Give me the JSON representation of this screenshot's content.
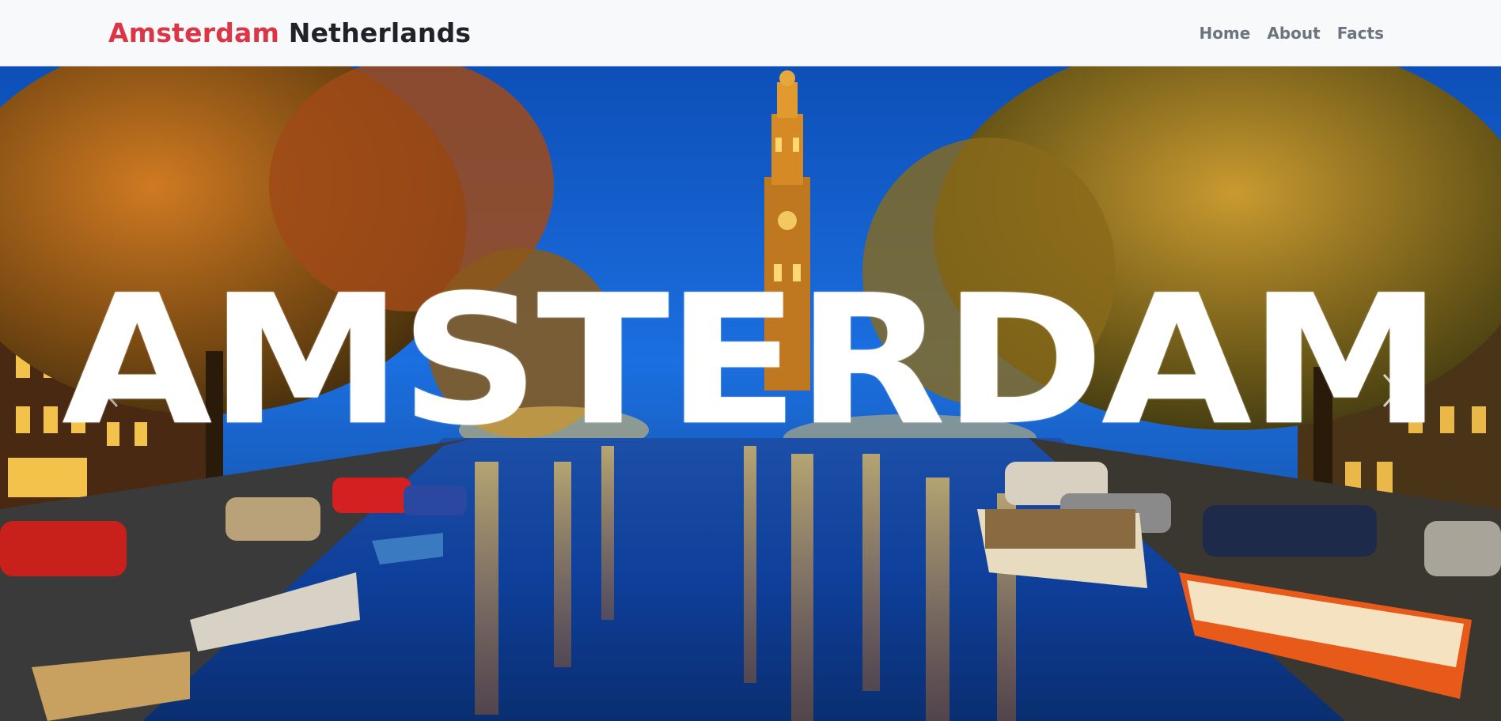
{
  "navbar": {
    "brand_primary": "Amsterdam",
    "brand_secondary": "Netherlands",
    "links": [
      "Home",
      "About",
      "Facts"
    ]
  },
  "hero": {
    "title": "AMSTERDAM",
    "prev_icon": "chevron-left-icon",
    "next_icon": "chevron-right-icon"
  },
  "colors": {
    "brand_red": "#dc3545",
    "brand_dark": "#1f2328",
    "nav_link": "#6c757d",
    "navbar_bg": "#f8f9fb"
  }
}
